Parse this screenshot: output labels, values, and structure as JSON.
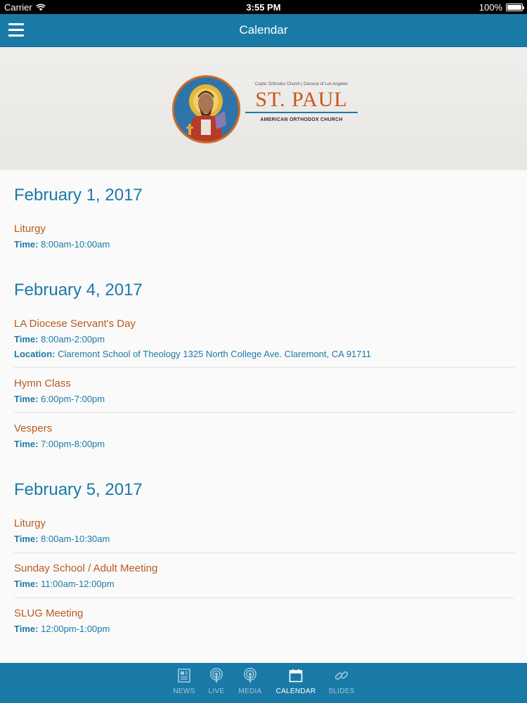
{
  "status_bar": {
    "carrier": "Carrier",
    "time": "3:55 PM",
    "battery": "100%"
  },
  "nav": {
    "title": "Calendar"
  },
  "header_logo": {
    "top_line": "Coptic Orthodox Church | Diocese of Los Angeles",
    "name": "ST. PAUL",
    "subtitle": "AMERICAN ORTHODOX CHURCH"
  },
  "labels": {
    "time": "Time:",
    "location": "Location:"
  },
  "days": [
    {
      "date": "February 1, 2017",
      "events": [
        {
          "name": "Liturgy",
          "time": "8:00am-10:00am"
        }
      ]
    },
    {
      "date": "February 4, 2017",
      "events": [
        {
          "name": "LA Diocese Servant's Day",
          "time": "8:00am-2:00pm",
          "location": "Claremont School of Theology 1325 North College Ave. Claremont, CA 91711"
        },
        {
          "name": "Hymn Class",
          "time": "6:00pm-7:00pm"
        },
        {
          "name": "Vespers",
          "time": "7:00pm-8:00pm"
        }
      ]
    },
    {
      "date": "February 5, 2017",
      "events": [
        {
          "name": "Liturgy",
          "time": "8:00am-10:30am"
        },
        {
          "name": "Sunday School / Adult Meeting",
          "time": "11:00am-12:00pm"
        },
        {
          "name": "SLUG Meeting",
          "time": "12:00pm-1:00pm"
        }
      ]
    }
  ],
  "tabs": [
    {
      "label": "NEWS",
      "icon": "news-icon"
    },
    {
      "label": "LIVE",
      "icon": "podcast-icon"
    },
    {
      "label": "MEDIA",
      "icon": "podcast-icon"
    },
    {
      "label": "CALENDAR",
      "icon": "calendar-icon",
      "active": true
    },
    {
      "label": "SLIDES",
      "icon": "link-icon"
    }
  ],
  "colors": {
    "accent": "#1a7aa7",
    "event_title": "#b85a1f"
  }
}
